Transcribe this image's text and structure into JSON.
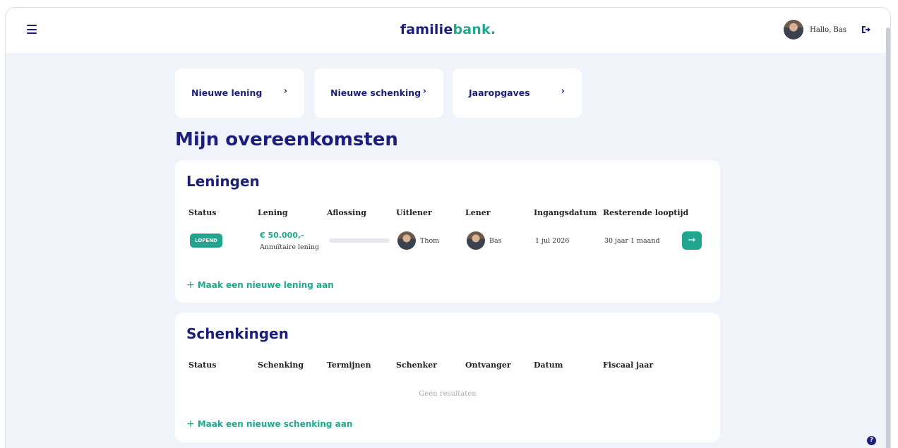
{
  "header": {
    "logo_part1": "familie",
    "logo_part2": "bank.",
    "greeting": "Hallo, Bas",
    "icons": {
      "menu": "hamburger-icon",
      "logout": "logout-icon"
    }
  },
  "quick_actions": [
    {
      "label": "Nieuwe lening",
      "icon": "chevron-right-icon"
    },
    {
      "label": "Nieuwe schenking",
      "icon": "chevron-right-icon"
    },
    {
      "label": "Jaaropgaves",
      "icon": "chevron-right-icon"
    }
  ],
  "page_title": "Mijn overeenkomsten",
  "loans": {
    "title": "Leningen",
    "columns": [
      "Status",
      "Lening",
      "Aflossing",
      "Uitlener",
      "Lener",
      "Ingangsdatum",
      "Resterende looptijd"
    ],
    "rows": [
      {
        "status": "LOPEND",
        "amount": "€ 50.000,-",
        "type": "Annuïtaire lening",
        "repayment_progress": 0,
        "lender": "Thom",
        "borrower": "Bas",
        "start_date": "1 jul 2026",
        "remaining": "30 jaar 1 maand"
      }
    ],
    "add_label": "Maak een nieuwe lening aan"
  },
  "gifts": {
    "title": "Schenkingen",
    "columns": [
      "Status",
      "Schenking",
      "Termijnen",
      "Schenker",
      "Ontvanger",
      "Datum",
      "Fiscaal jaar"
    ],
    "empty": "Geen resultaten",
    "add_label": "Maak een nieuwe schenking aan"
  },
  "colors": {
    "navy": "#1b1f7a",
    "teal": "#1fa98f",
    "background": "#f1f3fb"
  },
  "help_symbol": "?"
}
